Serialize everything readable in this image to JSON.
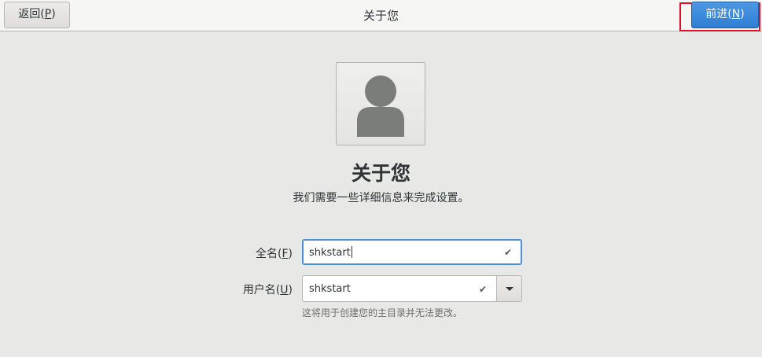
{
  "header": {
    "back_label": "返回(",
    "back_mnemonic": "P",
    "title": "关于您",
    "next_label": "前进(",
    "next_mnemonic": "N"
  },
  "main": {
    "title": "关于您",
    "subtitle": "我们需要一些详细信息来完成设置。"
  },
  "form": {
    "fullname": {
      "label": "全名(",
      "mnemonic": "F",
      "value": "shkstart"
    },
    "username": {
      "label": "用户名(",
      "mnemonic": "U",
      "value": "shkstart",
      "hint": "这将用于创建您的主目录并无法更改。"
    }
  },
  "icons": {
    "avatar": "user-avatar-icon",
    "check": "checkmark-icon",
    "dropdown": "chevron-down-icon"
  }
}
